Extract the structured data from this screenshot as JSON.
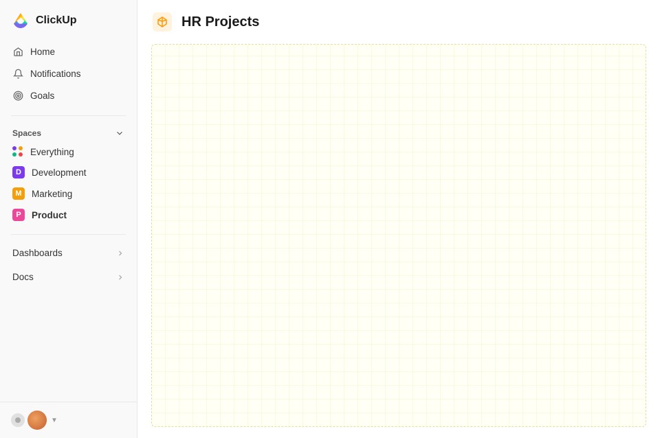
{
  "app": {
    "name": "ClickUp"
  },
  "sidebar": {
    "logo_text": "ClickUp",
    "nav_items": [
      {
        "id": "home",
        "label": "Home",
        "icon": "home"
      },
      {
        "id": "notifications",
        "label": "Notifications",
        "icon": "bell"
      },
      {
        "id": "goals",
        "label": "Goals",
        "icon": "target"
      }
    ],
    "spaces_label": "Spaces",
    "spaces": [
      {
        "id": "everything",
        "label": "Everything",
        "type": "everything"
      },
      {
        "id": "development",
        "label": "Development",
        "type": "avatar",
        "color": "#7c3aed",
        "letter": "D"
      },
      {
        "id": "marketing",
        "label": "Marketing",
        "type": "avatar",
        "color": "#f59e0b",
        "letter": "M"
      },
      {
        "id": "product",
        "label": "Product",
        "type": "avatar",
        "color": "#ec4899",
        "letter": "P",
        "active": true
      }
    ],
    "expandable_items": [
      {
        "id": "dashboards",
        "label": "Dashboards"
      },
      {
        "id": "docs",
        "label": "Docs"
      }
    ]
  },
  "main": {
    "page_title": "HR Projects",
    "page_icon": "cube"
  }
}
